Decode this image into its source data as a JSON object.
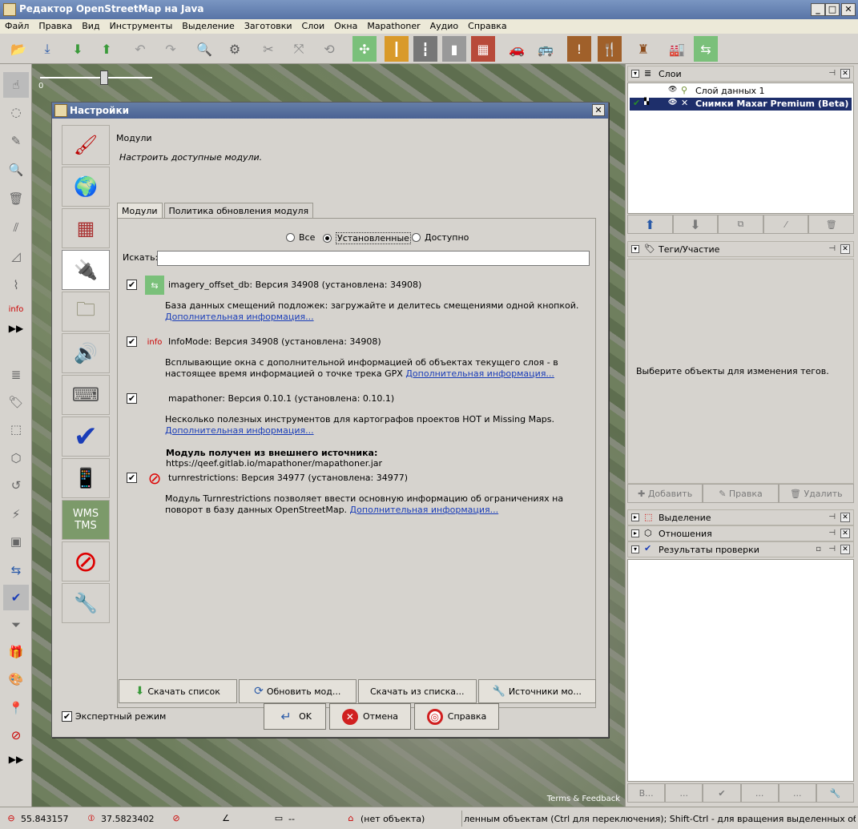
{
  "window": {
    "title": "Редактор OpenStreetMap на Java",
    "minimize": "_",
    "maximize": "□",
    "close": "✕"
  },
  "menu": [
    "Файл",
    "Правка",
    "Вид",
    "Инструменты",
    "Выделение",
    "Заготовки",
    "Слои",
    "Окна",
    "Mapathoner",
    "Аудио",
    "Справка"
  ],
  "zoom_slider": {
    "zero_label": "0",
    "level": 0.58
  },
  "map": {
    "credit": "Terms & Feedback"
  },
  "layers_panel": {
    "title": "Слои",
    "layers": [
      {
        "name": "Слой данных 1",
        "active": false
      },
      {
        "name": "Снимки Maxar Premium (Beta)",
        "active": true
      }
    ]
  },
  "tags_panel": {
    "title": "Теги/Участие",
    "empty_message": "Выберите объекты для изменения тегов.",
    "buttons": [
      "Добавить",
      "Правка",
      "Удалить"
    ]
  },
  "selection_panel": {
    "title": "Выделение"
  },
  "relations_panel": {
    "title": "Отношения"
  },
  "validation_panel": {
    "title": "Результаты проверки",
    "buttons": [
      "В...",
      "...",
      "...",
      "...",
      "...",
      "..."
    ]
  },
  "status": {
    "lat": "55.843157",
    "lon": "37.5823402",
    "dist": "--",
    "object": "(нет объекта)",
    "hint": "ленным объектам (Ctrl для переключения); Shift-Ctrl - для вращения выделенных объектов; A"
  },
  "dialog": {
    "title": "Настройки",
    "section_title": "Модули",
    "section_subtitle": "Настроить доступные модули.",
    "tabs": [
      "Модули",
      "Политика обновления модуля"
    ],
    "filter": {
      "all": "Все",
      "installed": "Установленные",
      "available": "Доступно",
      "selected": "installed"
    },
    "search_label": "Искать:",
    "search_value": "",
    "plugins": [
      {
        "name": "imagery_offset_db: Версия 34908 (установлена: 34908)",
        "desc": "База данных смещений подложек: загружайте и делитесь смещениями одной кнопкой.",
        "link": "Дополнительная информация...",
        "checked": true
      },
      {
        "name": "InfoMode: Версия 34908 (установлена: 34908)",
        "desc": "Всплывающие окна с дополнительной информацией об объектах текущего слоя - в настоящее время информацией о точке трека GPX",
        "link": "Дополнительная информация...",
        "checked": true
      },
      {
        "name": "mapathoner: Версия 0.10.1 (установлена: 0.10.1)",
        "desc": "Несколько полезных инструментов для картографов проектов HOT и Missing Maps.",
        "link": "Дополнительная информация...",
        "external_label": "Модуль получен из внешнего источника:",
        "external_url": "https://qeef.gitlab.io/mapathoner/mapathoner.jar",
        "checked": true
      },
      {
        "name": "turnrestrictions: Версия 34977 (установлена: 34977)",
        "desc": "Модуль Turnrestrictions позволяет ввести основную информацию об ограничениях на поворот в базу данных OpenStreetMap.",
        "link": "Дополнительная информация...",
        "checked": true
      }
    ],
    "bottom_buttons": [
      "Скачать список",
      "Обновить мод...",
      "Скачать из списка...",
      "Источники мо..."
    ],
    "expert_mode": "Экспертный режим",
    "ok": "OK",
    "cancel": "Отмена",
    "help": "Справка",
    "categories": [
      "display",
      "map",
      "grid",
      "plugins",
      "files",
      "audio",
      "keyboard",
      "validator",
      "remote",
      "wms-tms",
      "turnrestrictions",
      "advanced"
    ],
    "wms_label": "WMS\nTMS"
  }
}
